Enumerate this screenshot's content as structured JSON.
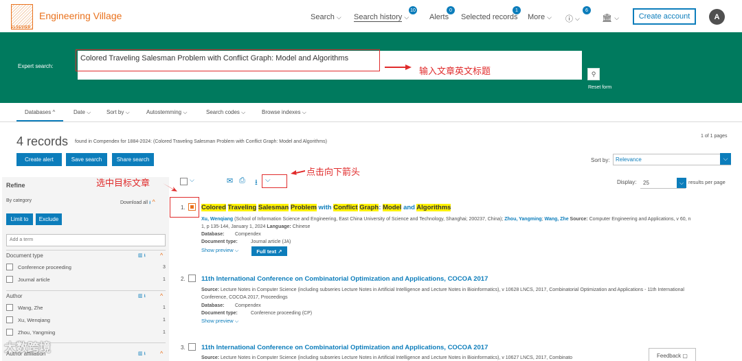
{
  "brand": {
    "name": "Engineering Village",
    "logo_text": "ELSEVIER"
  },
  "nav": {
    "search": "Search",
    "search_history": "Search history",
    "search_history_badge": "10",
    "alerts": "Alerts",
    "alerts_badge": "0",
    "selected_records": "Selected records",
    "selected_badge": "1",
    "more": "More",
    "help_badge": "6",
    "create_account": "Create account",
    "avatar_initial": "A"
  },
  "search": {
    "label": "Expert search:",
    "query": "Colored Traveling Salesman Problem with Conflict Graph: Model and Algorithms",
    "reset": "Reset form",
    "annotation": "输入文章英文标题"
  },
  "filters": [
    "Databases",
    "Date",
    "Sort by",
    "Autostemming",
    "Search codes",
    "Browse indexes"
  ],
  "results_header": {
    "count": "4 records",
    "found": "found in Compendex for 1884-2024: (Colored Traveling Salesman Problem with Conflict Graph: Model and Algorithms)",
    "pages": "1 of 1 pages",
    "create_alert": "Create alert",
    "save_search": "Save search",
    "share_search": "Share search",
    "sort_label": "Sort by:",
    "sort_value": "Relevance",
    "display_label": "Display:",
    "display_value": "25",
    "results_per_page": "results per page",
    "annotation_arrow": "点击向下箭头",
    "annotation_select": "选中目标文章"
  },
  "refine": {
    "title": "Refine",
    "by_category": "By category",
    "download_all": "Download all",
    "limit_to": "Limit to",
    "exclude": "Exclude",
    "add_term": "Add a term",
    "doc_type": {
      "heading": "Document type",
      "items": [
        {
          "label": "Conference proceeding",
          "count": "3"
        },
        {
          "label": "Journal article",
          "count": "1"
        }
      ]
    },
    "author": {
      "heading": "Author",
      "items": [
        {
          "label": "Wang, Zhe",
          "count": "1"
        },
        {
          "label": "Xu, Wenqiang",
          "count": "1"
        },
        {
          "label": "Zhou, Yangming",
          "count": "1"
        }
      ]
    },
    "affiliation": {
      "heading": "Author affiliation"
    }
  },
  "results": [
    {
      "num": "1.",
      "title_parts": [
        "Colored",
        " ",
        "Traveling",
        " ",
        "Salesman",
        " ",
        "Problem",
        " with ",
        "Conflict",
        " ",
        "Graph",
        ": ",
        "Model",
        " and ",
        "Algorithms"
      ],
      "author1": "Xu, Wenqiang",
      "aff1": " (School of Information Science and Engineering, East China University of Science and Technology, Shanghai; 200237, China); ",
      "author2": "Zhou, Yangming",
      "author3": "Wang, Zhe",
      "source_label": " Source:",
      "source": " Computer Engineering and Applications, v 60, n 1, p 135-144, January 1, 2024 ",
      "lang_label": "Language:",
      "lang": " Chinese",
      "database_label": "Database:",
      "database": "Compendex",
      "doctype_label": "Document type:",
      "doctype": "Journal article (JA)",
      "show_preview": "Show preview",
      "full_text": "Full text"
    },
    {
      "num": "2.",
      "title": "11th International Conference on Combinatorial Optimization and Applications, COCOA 2017",
      "source_label": "Source:",
      "source": " Lecture Notes in Computer Science (including subseries Lecture Notes in Artificial Intelligence and Lecture Notes in Bioinformatics), v 10628 LNCS, 2017, Combinatorial Optimization and Applications - 11th International Conference, COCOA 2017, Proceedings",
      "database_label": "Database:",
      "database": "Compendex",
      "doctype_label": "Document type:",
      "doctype": "Conference proceeding (CP)",
      "show_preview": "Show preview"
    },
    {
      "num": "3.",
      "title": "11th International Conference on Combinatorial Optimization and Applications, COCOA 2017",
      "source_label": "Source:",
      "source": " Lecture Notes in Computer Science (including subseries Lecture Notes in Artificial Intelligence and Lecture Notes in Bioinformatics), v 10627 LNCS, 2017, Combinato"
    }
  ],
  "feedback": "Feedback",
  "watermark": "大数跨境",
  "colors": {
    "brand_orange": "#e9711c",
    "banner_green": "#007a5e",
    "link_blue": "#0c7dbb",
    "annotation_red": "#e02b2b",
    "highlight": "#fff200"
  }
}
